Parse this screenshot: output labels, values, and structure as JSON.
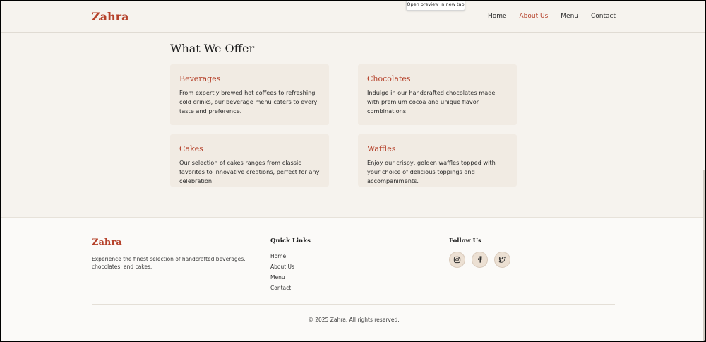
{
  "header": {
    "logo": "Zahra",
    "nav": [
      {
        "label": "Home",
        "active": false
      },
      {
        "label": "About Us",
        "active": true
      },
      {
        "label": "Menu",
        "active": false
      },
      {
        "label": "Contact",
        "active": false
      }
    ]
  },
  "tooltip": "Open preview in new tab",
  "offer": {
    "title": "What We Offer",
    "cards": [
      {
        "title": "Beverages",
        "text": "From expertly brewed hot coffees to refreshing cold drinks, our beverage menu caters to every taste and preference."
      },
      {
        "title": "Chocolates",
        "text": "Indulge in our handcrafted chocolates made with premium cocoa and unique flavor combinations."
      },
      {
        "title": "Cakes",
        "text": "Our selection of cakes ranges from classic favorites to innovative creations, perfect for any celebration."
      },
      {
        "title": "Waffles",
        "text": "Enjoy our crispy, golden waffles topped with your choice of delicious toppings and accompaniments."
      }
    ]
  },
  "footer": {
    "logo": "Zahra",
    "description": "Experience the finest selection of handcrafted beverages, chocolates, and cakes.",
    "quick_links_title": "Quick Links",
    "links": [
      "Home",
      "About Us",
      "Menu",
      "Contact"
    ],
    "follow_title": "Follow Us",
    "social_icons": [
      "instagram-icon",
      "facebook-icon",
      "twitter-icon"
    ],
    "copyright": "© 2025 Zahra. All rights reserved."
  },
  "colors": {
    "accent": "#b5412a",
    "background": "#f6f3ee",
    "card": "#f1ebe3"
  }
}
